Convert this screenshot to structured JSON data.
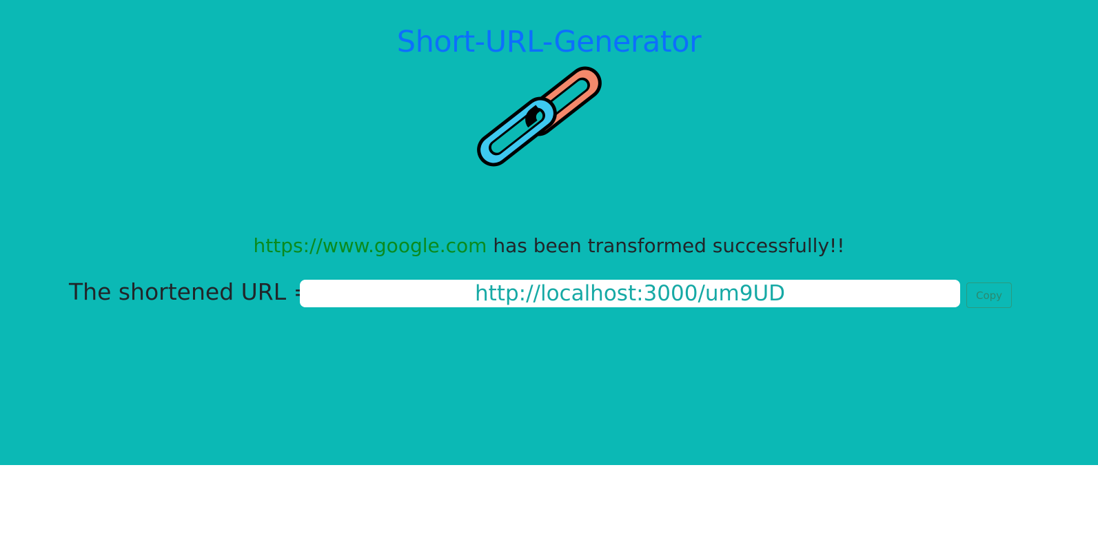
{
  "app": {
    "title": "Short-URL-Generator",
    "logo_icon": "chain-link-icon"
  },
  "result": {
    "original_url": "https://www.google.com",
    "message": " has been transformed successfully!!"
  },
  "shortened": {
    "label": "The shortened URL =",
    "value": "http://localhost:3000/um9UD",
    "copy_label": "Copy"
  },
  "colors": {
    "background": "#0bb9b5",
    "title": "#0d6efd",
    "original_url": "#0a8a1e",
    "short_url_text": "#16a9a5",
    "link_left": "#3ec9f0",
    "link_right": "#f4896b"
  }
}
